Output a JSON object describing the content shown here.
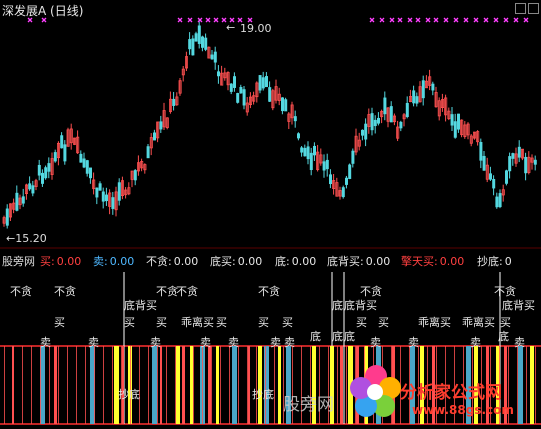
{
  "window": {
    "title": "深发展A (日线)"
  },
  "price_chart": {
    "high_label": "19.00",
    "low_label": "15.20"
  },
  "indicator": {
    "name": "股旁网",
    "fields": [
      {
        "label": "买:",
        "value": "0.00",
        "color": "#ff4040"
      },
      {
        "label": "卖:",
        "value": "0.00",
        "color": "#4fb8ff"
      },
      {
        "label": "不贪:",
        "value": "0.00",
        "color": "#e6e6e6"
      },
      {
        "label": "底买:",
        "value": "0.00",
        "color": "#e6e6e6"
      },
      {
        "label": "底:",
        "value": "0.00",
        "color": "#e6e6e6"
      },
      {
        "label": "底背买:",
        "value": "0.00",
        "color": "#e6e6e6"
      },
      {
        "label": "擎天买:",
        "value": "0.00",
        "color": "#ff4040"
      },
      {
        "label": "抄底:",
        "value": "0",
        "color": "#e6e6e6"
      }
    ],
    "signals": {
      "bu_tan": "不贪",
      "mai": "买",
      "mai_sell": "卖",
      "di_bei_mai": "底背买",
      "guai_li_mai": "乖离买",
      "di": "底",
      "chao_di": "抄底"
    }
  },
  "watermark": "股旁网",
  "logo": {
    "text": "分析家公式网",
    "url": "www.88gs.com"
  },
  "colors": {
    "up": "#ff5050",
    "down": "#54d8e0",
    "sell_bar": "#4aa7c8",
    "yellow_bar": "#ffff30",
    "grid_red": "#ff3030",
    "magenta": "#ff40ff"
  }
}
